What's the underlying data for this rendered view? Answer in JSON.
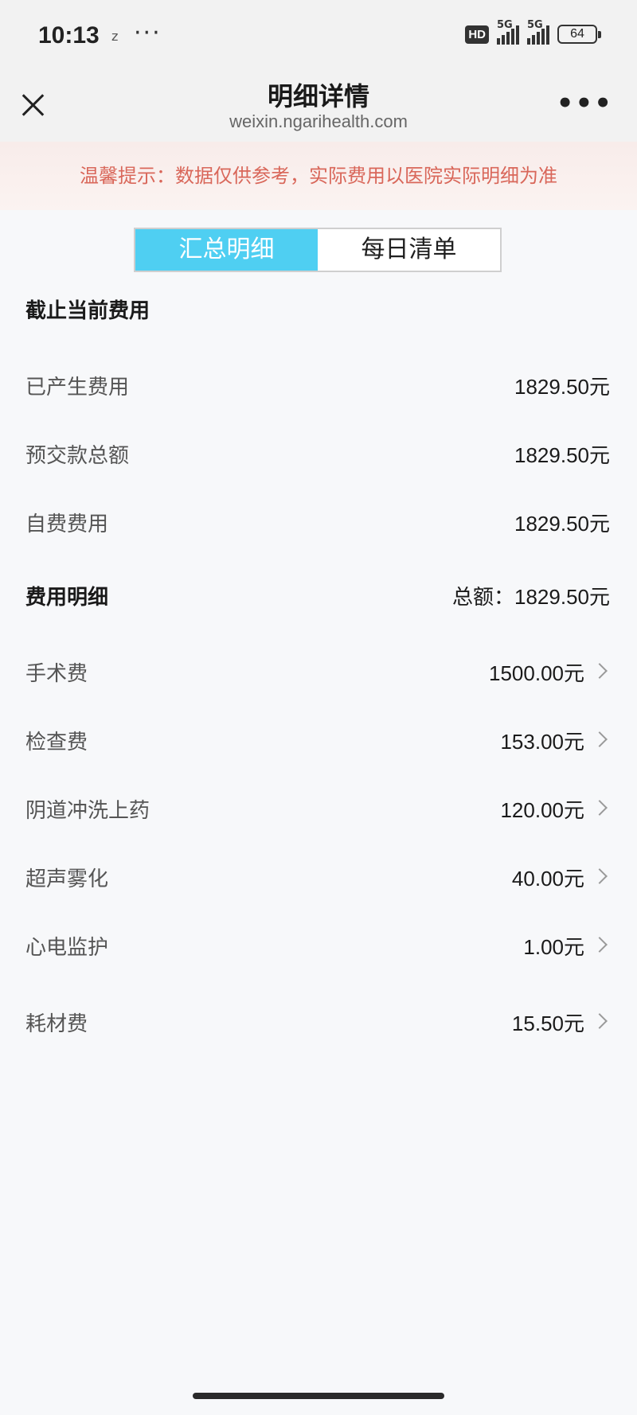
{
  "status_bar": {
    "time": "10:13",
    "z_glyph": "z",
    "dots": "···",
    "hd_label": "HD",
    "signal1_label": "5G",
    "signal2_label": "5G",
    "battery": "64"
  },
  "nav": {
    "title": "明细详情",
    "subtitle": "weixin.ngarihealth.com",
    "more": "•••"
  },
  "notice": {
    "text": "温馨提示：数据仅供参考，实际费用以医院实际明细为准",
    "color": "#d9675a"
  },
  "tabs": [
    {
      "label": "汇总明细",
      "active": true
    },
    {
      "label": "每日清单",
      "active": false
    }
  ],
  "summary": {
    "title": "截止当前费用",
    "rows": [
      {
        "label": "已产生费用",
        "value": "1829.50元"
      },
      {
        "label": "预交款总额",
        "value": "1829.50元"
      },
      {
        "label": "自费费用",
        "value": "1829.50元"
      }
    ]
  },
  "details": {
    "title": "费用明细",
    "total": "总额：1829.50元",
    "rows": [
      {
        "label": "手术费",
        "value": "1500.00元"
      },
      {
        "label": "检查费",
        "value": "153.00元"
      },
      {
        "label": "阴道冲洗上药",
        "value": "120.00元"
      },
      {
        "label": "超声雾化",
        "value": "40.00元"
      },
      {
        "label": "心电监护",
        "value": "1.00元"
      },
      {
        "label": "耗材费",
        "value": "15.50元"
      }
    ]
  },
  "colors": {
    "accent": "#4fcff2",
    "background": "#f7f8fa"
  }
}
